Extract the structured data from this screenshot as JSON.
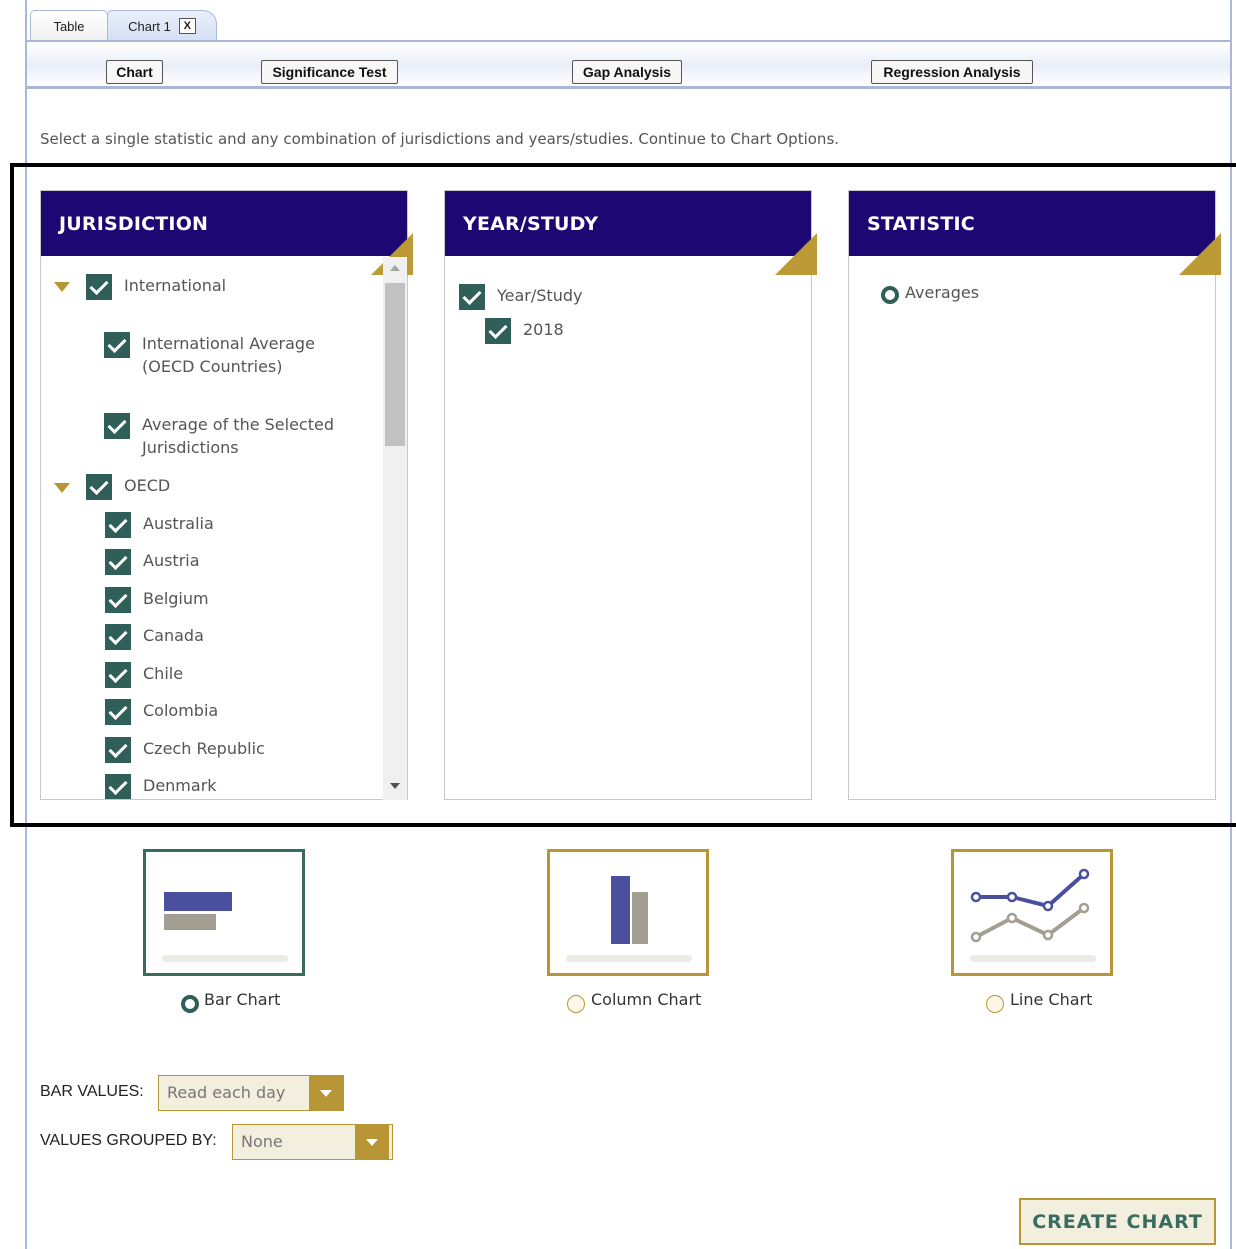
{
  "tabs": [
    {
      "label": "Table"
    },
    {
      "label": "Chart 1",
      "close": "X"
    }
  ],
  "toolbar": {
    "chart": "Chart",
    "significance": "Significance Test",
    "gap": "Gap Analysis",
    "regression": "Regression Analysis"
  },
  "instructions": "Select a single statistic and any combination of jurisdictions and years/studies. Continue to Chart Options.",
  "jurisdiction": {
    "title": "JURISDICTION",
    "groups": [
      {
        "label": "International",
        "items": [
          "International Average\n(OECD Countries)",
          "Average of the Selected\nJurisdictions"
        ]
      },
      {
        "label": "OECD",
        "items": [
          "Australia",
          "Austria",
          "Belgium",
          "Canada",
          "Chile",
          "Colombia",
          "Czech Republic",
          "Denmark"
        ]
      }
    ]
  },
  "year_study": {
    "title": "YEAR/STUDY",
    "group": "Year/Study",
    "item": "2018"
  },
  "statistic": {
    "title": "STATISTIC",
    "option": "Averages"
  },
  "chart_types": {
    "bar": "Bar Chart",
    "column": "Column Chart",
    "line": "Line Chart",
    "selected": "bar"
  },
  "bar_values": {
    "label": "BAR VALUES:",
    "value": "Read each day"
  },
  "grouped_by": {
    "label": "VALUES GROUPED BY:",
    "value": "None"
  },
  "create_button": "CREATE CHART",
  "colors": {
    "header": "#1d0773",
    "accent_gold": "#b89535",
    "check_green": "#2f5f58",
    "bar_blue": "#4a4f9e",
    "bar_gray": "#a39e92"
  }
}
